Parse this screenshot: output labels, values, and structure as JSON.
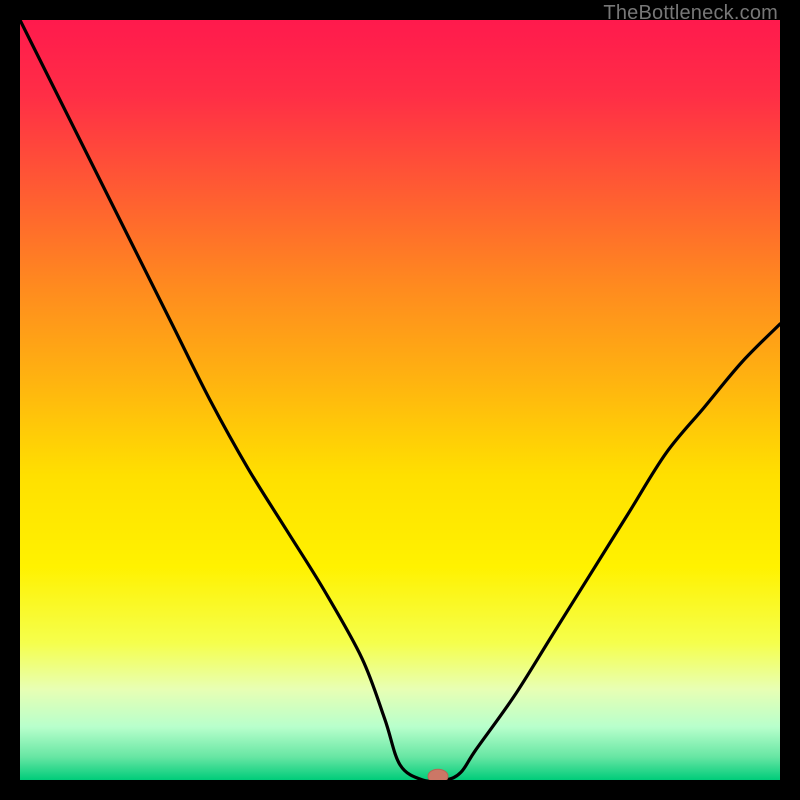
{
  "watermark": "TheBottleneck.com",
  "colors": {
    "black": "#000000",
    "curve": "#000000",
    "dot_fill": "#cc7766",
    "dot_stroke": "#b86655"
  },
  "chart_data": {
    "type": "line",
    "title": "",
    "xlabel": "",
    "ylabel": "",
    "xlim": [
      0,
      100
    ],
    "ylim": [
      0,
      100
    ],
    "grid": false,
    "series": [
      {
        "name": "bottleneck-curve",
        "x": [
          0,
          5,
          10,
          15,
          20,
          25,
          30,
          35,
          40,
          45,
          48,
          50,
          53,
          56,
          58,
          60,
          65,
          70,
          75,
          80,
          85,
          90,
          95,
          100
        ],
        "y": [
          100,
          90,
          80,
          70,
          60,
          50,
          41,
          33,
          25,
          16,
          8,
          2,
          0,
          0,
          1,
          4,
          11,
          19,
          27,
          35,
          43,
          49,
          55,
          60
        ]
      }
    ],
    "marker": {
      "x": 55,
      "y": 0.5
    },
    "background_gradient": {
      "stops": [
        {
          "pos": 0.0,
          "color": "#ff1a4d"
        },
        {
          "pos": 0.1,
          "color": "#ff2e46"
        },
        {
          "pos": 0.22,
          "color": "#ff5a33"
        },
        {
          "pos": 0.35,
          "color": "#ff8a1f"
        },
        {
          "pos": 0.48,
          "color": "#ffb50f"
        },
        {
          "pos": 0.6,
          "color": "#ffe000"
        },
        {
          "pos": 0.72,
          "color": "#fff200"
        },
        {
          "pos": 0.82,
          "color": "#f5ff4d"
        },
        {
          "pos": 0.88,
          "color": "#e8ffb3"
        },
        {
          "pos": 0.93,
          "color": "#b8ffcc"
        },
        {
          "pos": 0.97,
          "color": "#66e6a3"
        },
        {
          "pos": 1.0,
          "color": "#00cc7a"
        }
      ]
    }
  }
}
